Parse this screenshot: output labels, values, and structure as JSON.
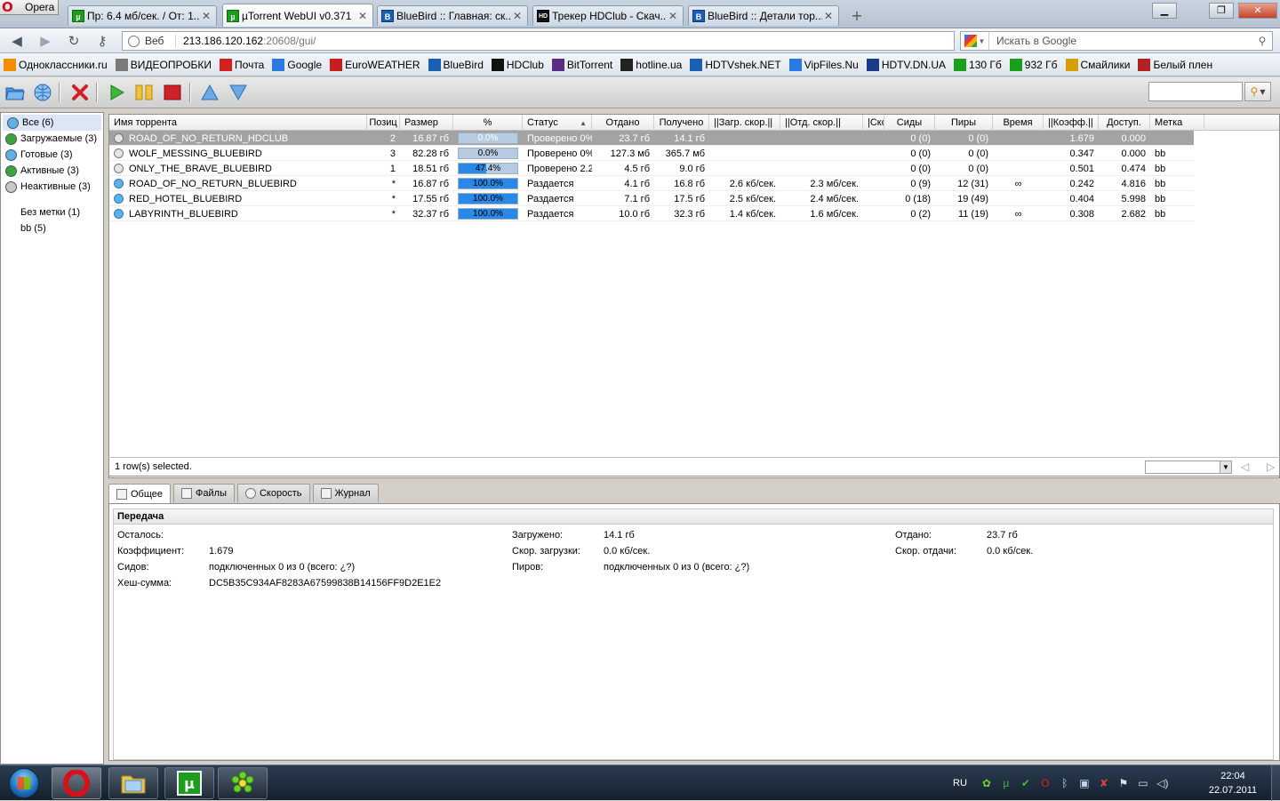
{
  "browser": {
    "menu_label": "Opera",
    "tabs": [
      {
        "title": "Пр: 6.4 мб/сек. / От: 1...",
        "icon": "utorrent-icon",
        "active": false
      },
      {
        "title": "µTorrent WebUI v0.371",
        "icon": "utorrent-icon",
        "active": true
      },
      {
        "title": "BlueBird :: Главная: ск...",
        "icon": "bluebird-icon",
        "active": false
      },
      {
        "title": "Трекер HDClub - Скач...",
        "icon": "hdclub-icon",
        "active": false
      },
      {
        "title": "BlueBird :: Детали тор...",
        "icon": "bluebird-icon",
        "active": false
      }
    ],
    "address": {
      "scope_label": "Веб",
      "host": "213.186.120.162",
      "path": ":20608/gui/"
    },
    "search_placeholder": "Искать в Google",
    "bookmarks": [
      {
        "label": "Одноклассники.ru",
        "color": "#f28c00"
      },
      {
        "label": "ВИДЕОПРОБКИ",
        "color": "#7a7a7a"
      },
      {
        "label": "Почта",
        "color": "#d42020"
      },
      {
        "label": "Google",
        "color": "#2a7ae2"
      },
      {
        "label": "EuroWEATHER",
        "color": "#c81e1e"
      },
      {
        "label": "BlueBird",
        "color": "#1a5fb4"
      },
      {
        "label": "HDClub",
        "color": "#111111"
      },
      {
        "label": "BitTorrent",
        "color": "#5a2d82"
      },
      {
        "label": "hotline.ua",
        "color": "#222222"
      },
      {
        "label": "HDTVshek.NET",
        "color": "#1a5fb4"
      },
      {
        "label": "VipFiles.Nu",
        "color": "#2a7ae2"
      },
      {
        "label": "HDTV.DN.UA",
        "color": "#1a3a8a"
      },
      {
        "label": "130 Гб",
        "color": "#1b9e1b"
      },
      {
        "label": "932 Гб",
        "color": "#1b9e1b"
      },
      {
        "label": "Смайлики",
        "color": "#d4a000"
      },
      {
        "label": "Белый плен",
        "color": "#b22222"
      }
    ]
  },
  "sidebar": {
    "categories": [
      {
        "label": "Все (6)",
        "color": "#5cb2e6",
        "selected": true
      },
      {
        "label": "Загружаемые (3)",
        "color": "#3aa53a",
        "selected": false
      },
      {
        "label": "Готовые (3)",
        "color": "#5cb2e6",
        "selected": false
      },
      {
        "label": "Активные (3)",
        "color": "#3aa53a",
        "selected": false
      },
      {
        "label": "Неактивные (3)",
        "color": "#c8c8c8",
        "selected": false
      }
    ],
    "labels": [
      {
        "label": "Без метки (1)"
      },
      {
        "label": "bb (5)"
      }
    ]
  },
  "torrent_list": {
    "columns": [
      "Имя торрента",
      "Позиц",
      "Размер",
      "%",
      "Статус",
      "Отдано",
      "Получено",
      "||Загр. скор.||",
      "||Отд. скор.||",
      "|Ско",
      "Сиды",
      "Пиры",
      "Время",
      "||Коэфф.||",
      "Доступ.",
      "Метка"
    ],
    "rows": [
      {
        "name": "ROAD_OF_NO_RETURN_HDCLUB",
        "pos": "2",
        "size": "16.87 гб",
        "percent": "0.0%",
        "progress": 0.0,
        "status": "Проверено 0%",
        "uploaded": "23.7 гб",
        "downloaded": "14.1 гб",
        "dl_speed": "",
        "ul_speed": "",
        "eta_extra": "",
        "seeds": "0 (0)",
        "peers": "0 (0)",
        "time": "",
        "ratio": "1.679",
        "avail": "0.000",
        "label": "",
        "seeding": false,
        "selected": true
      },
      {
        "name": "WOLF_MESSING_BLUEBIRD",
        "pos": "3",
        "size": "82.28 гб",
        "percent": "0.0%",
        "progress": 0.0,
        "status": "Проверено 0%",
        "uploaded": "127.3 мб",
        "downloaded": "365.7 мб",
        "dl_speed": "",
        "ul_speed": "",
        "eta_extra": "",
        "seeds": "0 (0)",
        "peers": "0 (0)",
        "time": "",
        "ratio": "0.347",
        "avail": "0.000",
        "label": "bb",
        "seeding": false,
        "selected": false
      },
      {
        "name": "ONLY_THE_BRAVE_BLUEBIRD",
        "pos": "1",
        "size": "18.51 гб",
        "percent": "47.4%",
        "progress": 47.4,
        "status": "Проверено 2.2'",
        "uploaded": "4.5 гб",
        "downloaded": "9.0 гб",
        "dl_speed": "",
        "ul_speed": "",
        "eta_extra": "",
        "seeds": "0 (0)",
        "peers": "0 (0)",
        "time": "",
        "ratio": "0.501",
        "avail": "0.474",
        "label": "bb",
        "seeding": false,
        "selected": false
      },
      {
        "name": "ROAD_OF_NO_RETURN_BLUEBIRD",
        "pos": "*",
        "size": "16.87 гб",
        "percent": "100.0%",
        "progress": 100.0,
        "status": "Раздается",
        "uploaded": "4.1 гб",
        "downloaded": "16.8 гб",
        "dl_speed": "2.6 кб/сек.",
        "ul_speed": "2.3 мб/сек.",
        "eta_extra": "",
        "seeds": "0 (9)",
        "peers": "12 (31)",
        "time": "∞",
        "ratio": "0.242",
        "avail": "4.816",
        "label": "bb",
        "seeding": true,
        "selected": false
      },
      {
        "name": "RED_HOTEL_BLUEBIRD",
        "pos": "*",
        "size": "17.55 гб",
        "percent": "100.0%",
        "progress": 100.0,
        "status": "Раздается",
        "uploaded": "7.1 гб",
        "downloaded": "17.5 гб",
        "dl_speed": "2.5 кб/сек.",
        "ul_speed": "2.4 мб/сек.",
        "eta_extra": "",
        "seeds": "0 (18)",
        "peers": "19 (49)",
        "time": "",
        "ratio": "0.404",
        "avail": "5.998",
        "label": "bb",
        "seeding": true,
        "selected": false
      },
      {
        "name": "LABYRINTH_BLUEBIRD",
        "pos": "*",
        "size": "32.37 гб",
        "percent": "100.0%",
        "progress": 100.0,
        "status": "Раздается",
        "uploaded": "10.0 гб",
        "downloaded": "32.3 гб",
        "dl_speed": "1.4 кб/сек.",
        "ul_speed": "1.6 мб/сек.",
        "eta_extra": "",
        "seeds": "0 (2)",
        "peers": "11 (19)",
        "time": "∞",
        "ratio": "0.308",
        "avail": "2.682",
        "label": "bb",
        "seeding": true,
        "selected": false
      }
    ],
    "status_text": "1 row(s) selected."
  },
  "details": {
    "tabs": [
      "Общее",
      "Файлы",
      "Скорость",
      "Журнал"
    ],
    "section_title": "Передача",
    "fields": {
      "remaining_label": "Осталось:",
      "remaining_value": "",
      "ratio_label": "Коэффициент:",
      "ratio_value": "1.679",
      "seeds_label": "Сидов:",
      "seeds_value": "подключенных 0 из 0 (всего: ¿?)",
      "hash_label": "Хеш-сумма:",
      "hash_value": "DC5B35C934AF8283A67599838B14156FF9D2E1E2",
      "downloaded_label": "Загружено:",
      "downloaded_value": "14.1 гб",
      "dl_speed_label": "Скор. загрузки:",
      "dl_speed_value": "0.0 кб/сек.",
      "peers_label": "Пиров:",
      "peers_value": "подключенных 0 из 0 (всего: ¿?)",
      "uploaded_label": "Отдано:",
      "uploaded_value": "23.7 гб",
      "ul_speed_label": "Скор. отдачи:",
      "ul_speed_value": "0.0 кб/сек."
    }
  },
  "taskbar": {
    "lang": "RU",
    "time": "22:04",
    "date": "22.07.2011"
  }
}
